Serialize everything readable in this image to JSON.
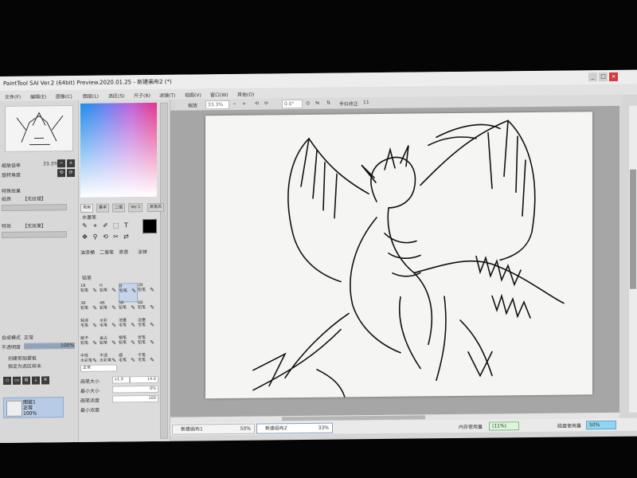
{
  "window": {
    "title": "PaintTool SAI Ver.2 (64bit) Preview.2020.01.25 - 新建画布2 (*)",
    "buttons": [
      "_",
      "□",
      "×"
    ]
  },
  "menu": [
    "文件(F)",
    "编辑(E)",
    "图像(C)",
    "图层(L)",
    "选区(S)",
    "尺子(R)",
    "滤镜(T)",
    "视图(V)",
    "窗口(W)",
    "其他(O)"
  ],
  "toolbar": {
    "zoom_label": "缩放",
    "zoom_value": "33.3%",
    "angle_value": "0.0°",
    "stabilizer_label": "手抖修正",
    "stabilizer_value": "11"
  },
  "navigator": {
    "zoom_label": "缩放倍率",
    "zoom_value": "33.3%",
    "angle_label": "旋转角度",
    "angle_value": "0"
  },
  "layer_panel": {
    "effects_title": "特殊效果",
    "paper_texture_label": "纸质",
    "paper_texture_value": "【无纹理】",
    "effect_label": "特效",
    "effect_value": "【无效果】",
    "blend_label": "合成模式",
    "blend_value": "正常",
    "opacity_label": "不透明度",
    "opacity_value": "100%",
    "opacity_fraction": 1.0,
    "clip_label": "创建剪贴蒙板",
    "select_source_label": "指定为选区样本",
    "layer_name": "图层1",
    "layer_mode": "正常",
    "layer_opacity": "100%"
  },
  "tool_panel": {
    "tabs": [
      "常用",
      "基本",
      "二值",
      "Ver.1",
      "黑笔风"
    ],
    "subtab": "水墨笔",
    "tools_row1": [
      "✎",
      "⌖",
      "✐",
      "⬚",
      "T"
    ],
    "tools_row2": [
      "✥",
      "⚲",
      "⟲",
      "✂",
      "⇄"
    ],
    "brush_categories": [
      "油漆桶",
      "二值笔",
      "渗透",
      "涂抹"
    ],
    "default_label": "铅笔",
    "brushes": [
      {
        "size": "1B",
        "name": "铅笔"
      },
      {
        "size": "H",
        "name": "铅笔"
      },
      {
        "size": "B",
        "name": "铅笔"
      },
      {
        "size": "2B",
        "name": "铅笔"
      },
      {
        "size": "3B",
        "name": "铅笔"
      },
      {
        "size": "4B",
        "name": "铅笔"
      },
      {
        "size": "5B",
        "name": "铅笔"
      },
      {
        "size": "6B",
        "name": "铅笔"
      },
      {
        "size": "粘液",
        "name": "毛笔"
      },
      {
        "size": "水彩",
        "name": "毛笔"
      },
      {
        "size": "浓墨",
        "name": "毛笔"
      },
      {
        "size": "淡墨",
        "name": "毛笔"
      },
      {
        "size": "赋予",
        "name": "铅笔"
      },
      {
        "size": "金尖",
        "name": "铅笔"
      },
      {
        "size": "钢笔",
        "name": "铅笔"
      },
      {
        "size": "炭笔",
        "name": "铅笔"
      },
      {
        "size": "中性",
        "name": "水彩笔"
      },
      {
        "size": "不透",
        "name": "水彩笔"
      },
      {
        "size": "细",
        "name": "毛笔"
      },
      {
        "size": "干笔",
        "name": "毛笔"
      }
    ],
    "mode_value": "正常",
    "brush_size_label": "画笔大小",
    "brush_size_multiplier": "x1.0",
    "brush_size_value": "14.0",
    "min_size_label": "最小大小",
    "min_size_value": "0%",
    "density_label": "画笔浓度",
    "density_value": "100",
    "min_density_label": "最小浓度"
  },
  "status_bar": {
    "documents": [
      {
        "name": "新建画布1",
        "zoom": "50%"
      },
      {
        "name": "新建画布2",
        "zoom": "33%"
      }
    ],
    "memory_label": "内存使用量",
    "memory_value": "(11%)",
    "disk_label": "磁盘使用量",
    "disk_value": "50%"
  }
}
